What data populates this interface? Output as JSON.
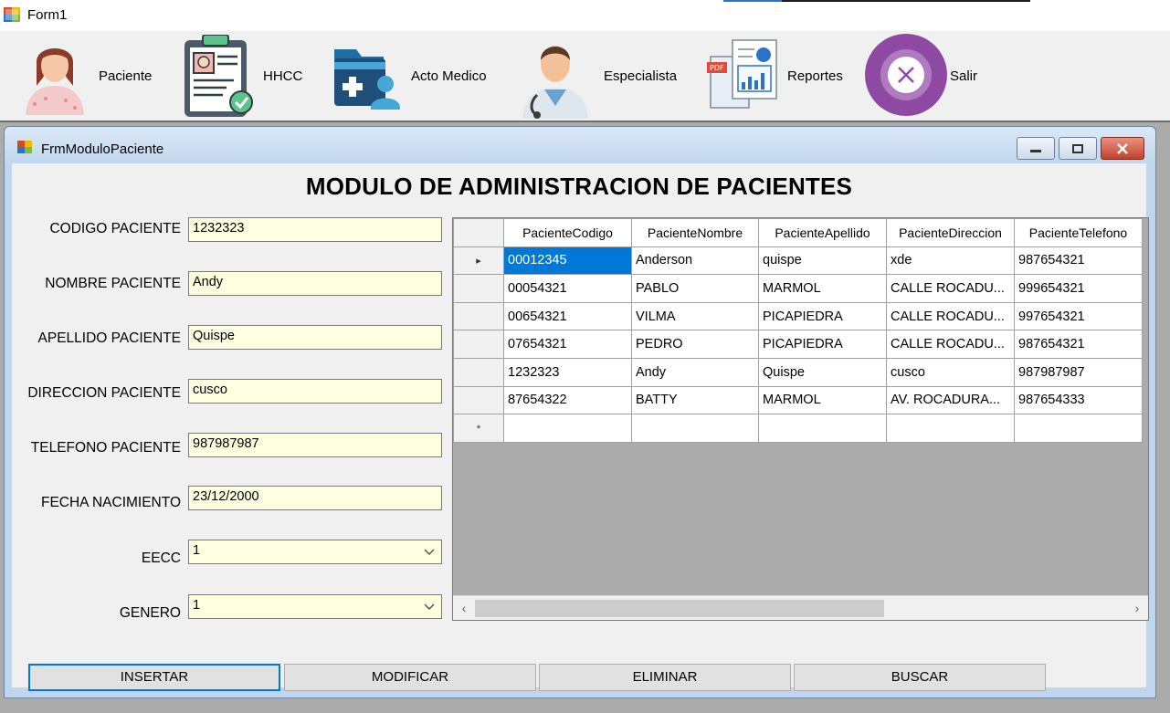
{
  "window": {
    "title": "Form1"
  },
  "toolbar": {
    "items": [
      {
        "label": "Paciente",
        "icon": "patient-avatar-icon"
      },
      {
        "label": "HHCC",
        "icon": "clinical-record-clipboard-icon"
      },
      {
        "label": "Acto Medico",
        "icon": "medical-folder-icon"
      },
      {
        "label": "Especialista",
        "icon": "doctor-avatar-icon"
      },
      {
        "label": "Reportes",
        "icon": "reports-document-icon"
      },
      {
        "label": "Salir",
        "icon": "exit-circle-icon"
      }
    ]
  },
  "child_window": {
    "title": "FrmModuloPaciente",
    "controls": {
      "minimize": "minimize-icon",
      "restore": "restore-icon",
      "close": "close-icon"
    }
  },
  "form": {
    "heading": "MODULO DE ADMINISTRACION DE PACIENTES",
    "fields": {
      "codigo": {
        "label": "CODIGO PACIENTE",
        "value": "1232323"
      },
      "nombre": {
        "label": "NOMBRE PACIENTE",
        "value": "Andy"
      },
      "apellido": {
        "label": "APELLIDO PACIENTE",
        "value": "Quispe"
      },
      "direccion": {
        "label": "DIRECCION PACIENTE",
        "value": "cusco"
      },
      "telefono": {
        "label": "TELEFONO PACIENTE",
        "value": "987987987"
      },
      "fecha": {
        "label": "FECHA NACIMIENTO",
        "value": "23/12/2000"
      },
      "eecc": {
        "label": "EECC",
        "value": "1"
      },
      "genero": {
        "label": "GENERO",
        "value": "1"
      }
    },
    "buttons": {
      "insertar": "INSERTAR",
      "modificar": "MODIFICAR",
      "eliminar": "ELIMINAR",
      "buscar": "BUSCAR"
    }
  },
  "grid": {
    "columns": [
      "PacienteCodigo",
      "PacienteNombre",
      "PacienteApellido",
      "PacienteDireccion",
      "PacienteTelefono"
    ],
    "rows": [
      [
        "00012345",
        "Anderson",
        "quispe",
        "xde",
        "987654321"
      ],
      [
        "00054321",
        "PABLO",
        "MARMOL",
        "CALLE ROCADU...",
        "999654321"
      ],
      [
        "00654321",
        "VILMA",
        "PICAPIEDRA",
        "CALLE ROCADU...",
        "997654321"
      ],
      [
        "07654321",
        "PEDRO",
        "PICAPIEDRA",
        "CALLE ROCADU...",
        "987654321"
      ],
      [
        "1232323",
        "Andy",
        "Quispe",
        "cusco",
        "987987987"
      ],
      [
        "87654322",
        "BATTY",
        "MARMOL",
        "AV. ROCADURA...",
        "987654333"
      ]
    ],
    "current_row_marker": "▸",
    "new_row_marker": "*"
  },
  "colors": {
    "field_bg": "#ffffe1",
    "selection": "#0078d7",
    "mdi_bg": "#ababab",
    "child_frame": "#bfd6ee"
  }
}
